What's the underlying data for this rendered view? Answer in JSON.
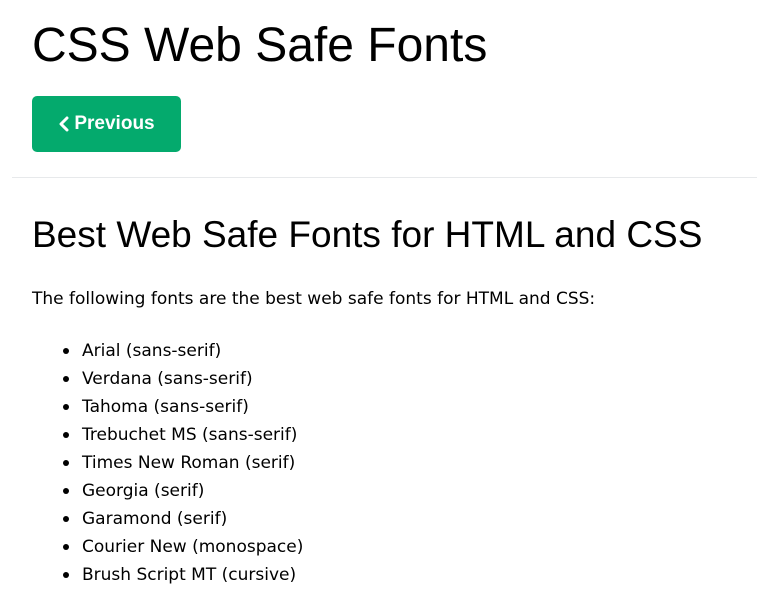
{
  "page": {
    "title": "CSS Web Safe Fonts",
    "previous_button": {
      "label": "Previous",
      "icon": "chevron-left-icon",
      "color": "#04aa6d"
    }
  },
  "section": {
    "heading": "Best Web Safe Fonts for HTML and CSS",
    "intro": "The following fonts are the best web safe fonts for HTML and CSS:",
    "fonts": [
      "Arial (sans-serif)",
      "Verdana (sans-serif)",
      "Tahoma (sans-serif)",
      "Trebuchet MS (sans-serif)",
      "Times New Roman (serif)",
      "Georgia (serif)",
      "Garamond (serif)",
      "Courier New (monospace)",
      "Brush Script MT (cursive)"
    ]
  }
}
